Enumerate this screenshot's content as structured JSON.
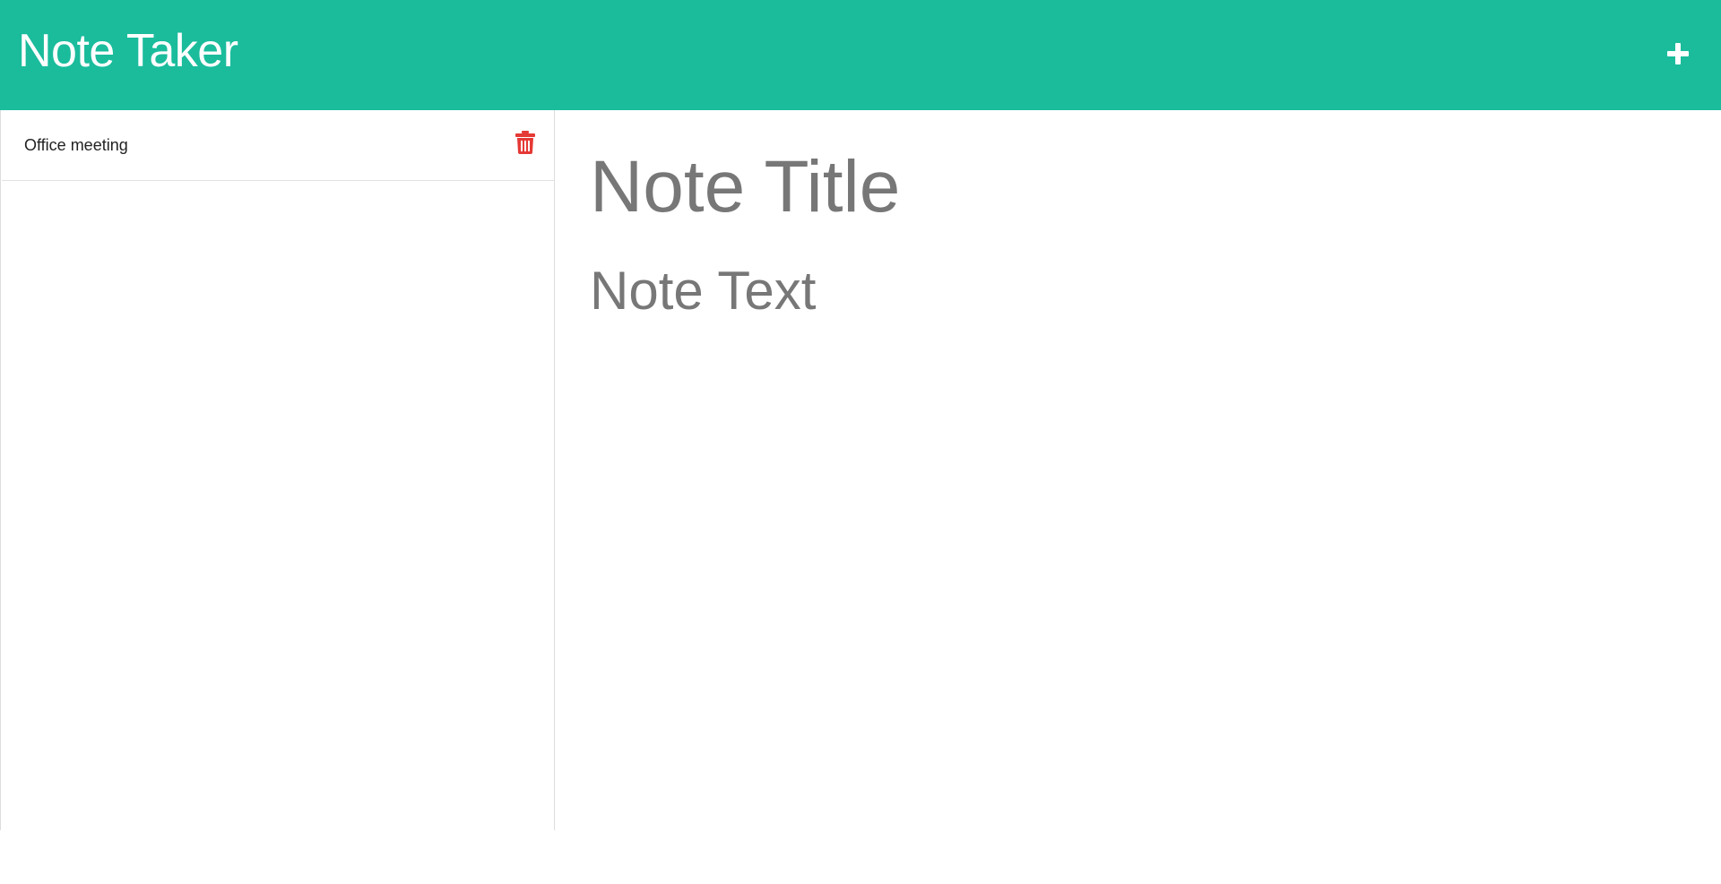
{
  "navbar": {
    "title": "Note Taker",
    "background_color": "#1abc9c",
    "new_note_icon": "plus-icon"
  },
  "sidebar": {
    "notes": [
      {
        "title": "Office meeting",
        "delete_icon": "trash-icon",
        "delete_icon_color": "#e53935"
      }
    ]
  },
  "editor": {
    "title_placeholder": "Note Title",
    "text_placeholder": "Note Text",
    "placeholder_color": "#777777"
  }
}
